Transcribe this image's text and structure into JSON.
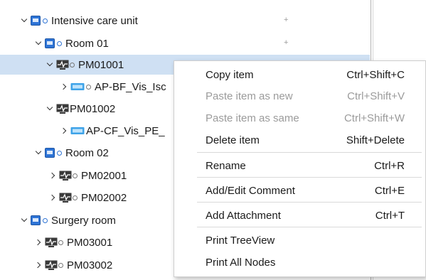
{
  "tree": {
    "nodes": [
      {
        "label": "Intensive care unit",
        "type": "folder",
        "expanded": true
      },
      {
        "label": "Room 01",
        "type": "folder",
        "expanded": true
      },
      {
        "label": "PM01001",
        "type": "monitor",
        "expanded": true,
        "selected": true
      },
      {
        "label": "AP-BF_Vis_Isc",
        "type": "device",
        "expanded": false
      },
      {
        "label": "PM01002",
        "type": "monitor",
        "expanded": true
      },
      {
        "label": "AP-CF_Vis_PE_",
        "type": "device",
        "expanded": false
      },
      {
        "label": "Room 02",
        "type": "folder",
        "expanded": true
      },
      {
        "label": "PM02001",
        "type": "monitor",
        "expanded": false
      },
      {
        "label": "PM02002",
        "type": "monitor",
        "expanded": false
      },
      {
        "label": "Surgery room",
        "type": "folder",
        "expanded": true
      },
      {
        "label": "PM03001",
        "type": "monitor",
        "expanded": false
      },
      {
        "label": "PM03002",
        "type": "monitor",
        "expanded": false
      }
    ],
    "plus_marks": [
      "+",
      "+"
    ]
  },
  "context_menu": {
    "items": [
      {
        "label": "Copy item",
        "shortcut": "Ctrl+Shift+C",
        "enabled": true
      },
      {
        "label": "Paste item as new",
        "shortcut": "Ctrl+Shift+V",
        "enabled": false
      },
      {
        "label": "Paste item as same",
        "shortcut": "Ctrl+Shift+W",
        "enabled": false
      },
      {
        "label": "Delete item",
        "shortcut": "Shift+Delete",
        "enabled": true
      },
      {
        "label": "Rename",
        "shortcut": "Ctrl+R",
        "enabled": true
      },
      {
        "label": "Add/Edit Comment",
        "shortcut": "Ctrl+E",
        "enabled": true
      },
      {
        "label": "Add Attachment",
        "shortcut": "Ctrl+T",
        "enabled": true
      },
      {
        "label": "Print TreeView",
        "shortcut": "",
        "enabled": true
      },
      {
        "label": "Print All Nodes",
        "shortcut": "",
        "enabled": true
      }
    ]
  },
  "colors": {
    "selection": "#cfe0f3",
    "folder_icon": "#2e74d6",
    "disabled_text": "#9b9b9b"
  }
}
